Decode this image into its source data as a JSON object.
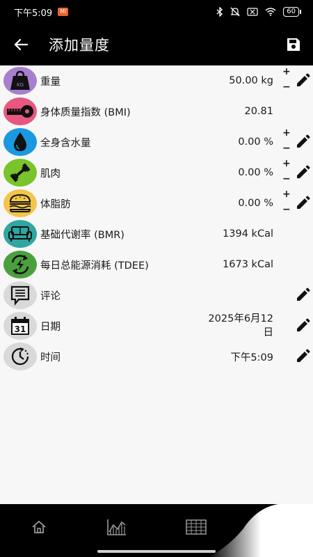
{
  "status_bar": {
    "time": "下午5:09",
    "badge": "Mi",
    "battery": "60"
  },
  "app_bar": {
    "title": "添加量度"
  },
  "rows": [
    {
      "label": "重量",
      "value": "50.00 kg",
      "icon": "weight-icon",
      "color": "#a77fcf",
      "adjustable": true,
      "editable": true
    },
    {
      "label": "身体质量指数 (BMI)",
      "value": "20.81",
      "icon": "tape-measure-icon",
      "color": "#e8577f",
      "adjustable": false,
      "editable": false
    },
    {
      "label": "全身含水量",
      "value": "0.00 %",
      "icon": "water-drop-icon",
      "color": "#1b99e0",
      "adjustable": true,
      "editable": true
    },
    {
      "label": "肌肉",
      "value": "0.00 %",
      "icon": "dumbbell-icon",
      "color": "#79c42d",
      "adjustable": true,
      "editable": true
    },
    {
      "label": "体脂肪",
      "value": "0.00 %",
      "icon": "burger-icon",
      "color": "#f3c548",
      "adjustable": true,
      "editable": true
    },
    {
      "label": "基础代谢率 (BMR)",
      "value": "1394 kCal",
      "icon": "sofa-icon",
      "color": "#2fa6a0",
      "adjustable": false,
      "editable": false
    },
    {
      "label": "每日总能源消耗 (TDEE)",
      "value": "1673 kCal",
      "icon": "energy-cycle-icon",
      "color": "#4ba03d",
      "adjustable": false,
      "editable": false
    },
    {
      "label": "评论",
      "value": "",
      "icon": "comment-icon",
      "color": "#d9d9d9",
      "adjustable": false,
      "editable": true
    },
    {
      "label": "日期",
      "value": "2025年6月12日",
      "value_line1": "2025年6月12",
      "value_line2": "日",
      "icon": "calendar-icon",
      "color": "#d9d9d9",
      "adjustable": false,
      "editable": true
    },
    {
      "label": "时间",
      "value": "下午5:09",
      "icon": "clock-icon",
      "color": "#d9d9d9",
      "adjustable": false,
      "editable": true
    }
  ],
  "controls": {
    "plus": "+",
    "minus": "−"
  },
  "bottom_nav": {
    "items": [
      "home-icon",
      "chart-icon",
      "table-icon"
    ]
  }
}
